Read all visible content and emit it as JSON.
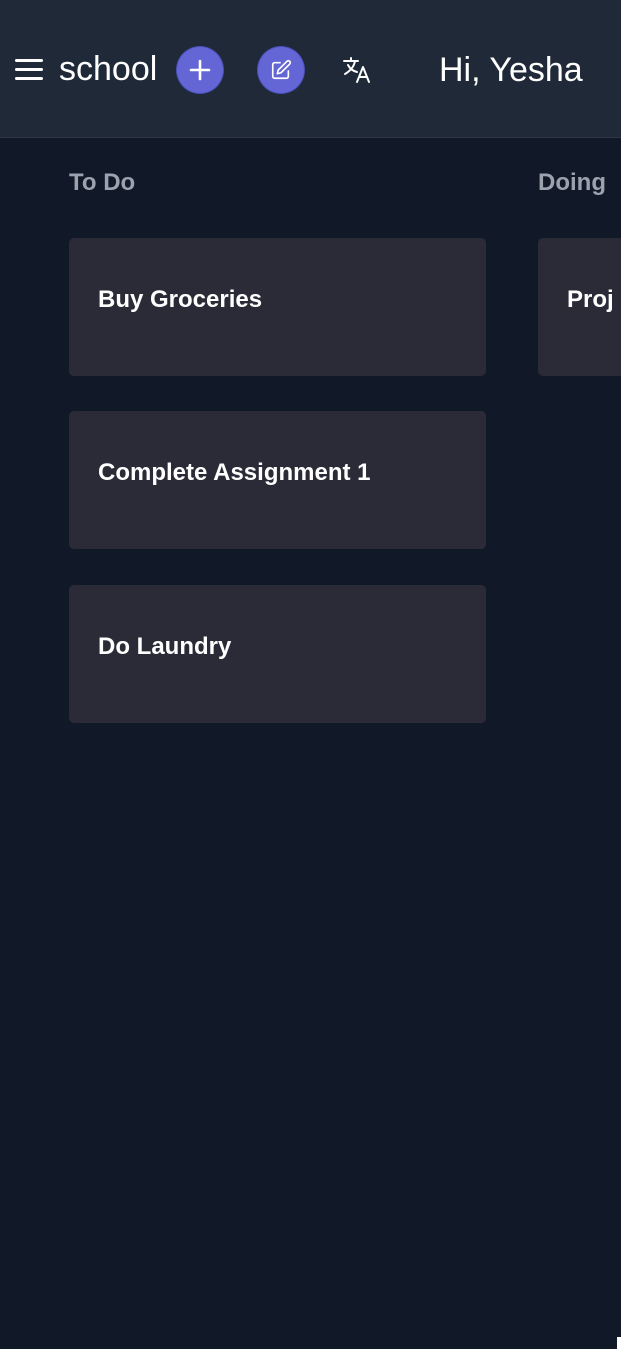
{
  "header": {
    "board_name": "school",
    "greeting": "Hi, Yesha",
    "icons": {
      "menu": "hamburger-menu-icon",
      "add": "plus-icon",
      "edit": "pencil-edit-icon",
      "translate": "translate-icon"
    }
  },
  "colors": {
    "background": "#111827",
    "header": "#1f2937",
    "card": "#2b2b38",
    "accent": "#6366d4",
    "column_title": "#9ca3af",
    "text": "#ffffff"
  },
  "columns": [
    {
      "title": "To Do",
      "cards": [
        {
          "title": "Buy Groceries"
        },
        {
          "title": "Complete Assignment 1"
        },
        {
          "title": "Do Laundry"
        }
      ]
    },
    {
      "title": "Doing",
      "cards": [
        {
          "title": "Proj"
        }
      ]
    }
  ]
}
